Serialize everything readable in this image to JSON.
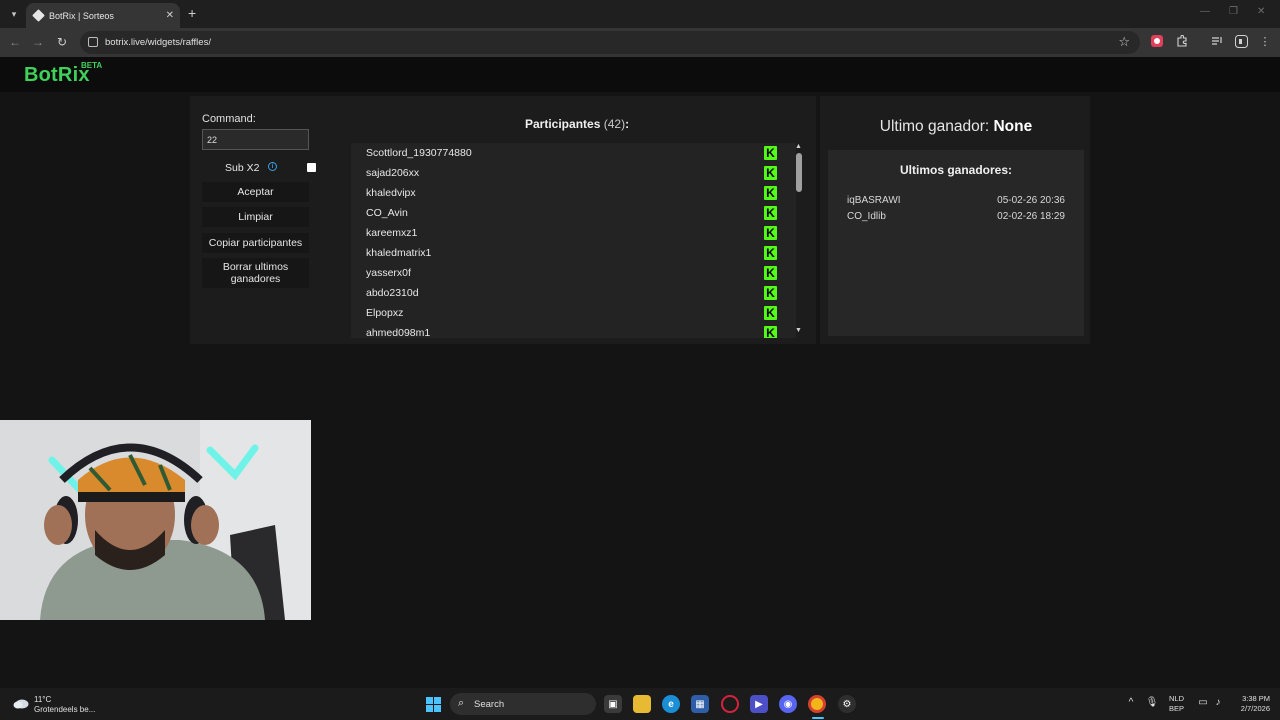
{
  "browser": {
    "tab_title": "BotRix | Sorteos",
    "url": "botrix.live/widgets/raffles/"
  },
  "header": {
    "logo": "BotRix",
    "badge": "BETA"
  },
  "controls": {
    "command_label": "Command:",
    "command_value": "22",
    "sub_label": "Sub X2",
    "sub_checked": false,
    "accept": "Aceptar",
    "clear": "Limpiar",
    "copy": "Copiar participantes",
    "delete_winners_line1": "Borrar ultimos",
    "delete_winners_line2": "ganadores"
  },
  "participants": {
    "title": "Participantes",
    "count": "(42)",
    "colon": ":",
    "items": [
      "Scottlord_1930774880",
      "sajad206xx",
      "khaledvipx",
      "CO_Avin",
      "kareemxz1",
      "khaledmatrix1",
      "yasserx0f",
      "abdo2310d",
      "Elpopxz",
      "ahmed098m1"
    ],
    "platform_badge": "K"
  },
  "winner": {
    "label": "Ultimo ganador:",
    "value": "None",
    "history_title": "Ultimos ganadores:",
    "history": [
      {
        "name": "iqBASRAWI",
        "date": "05-02-26 20:36"
      },
      {
        "name": "CO_Idlib",
        "date": "02-02-26 18:29"
      }
    ]
  },
  "taskbar": {
    "temp": "11°C",
    "weather": "Grotendeels be...",
    "search": "Search",
    "lang1": "NLD",
    "lang2": "BEP",
    "time": "3:38 PM",
    "date": "2/7/2026"
  },
  "colors": {
    "brand_green": "#3fd15a",
    "kick_green": "#53fc18",
    "panel": "#1c1c1c"
  }
}
